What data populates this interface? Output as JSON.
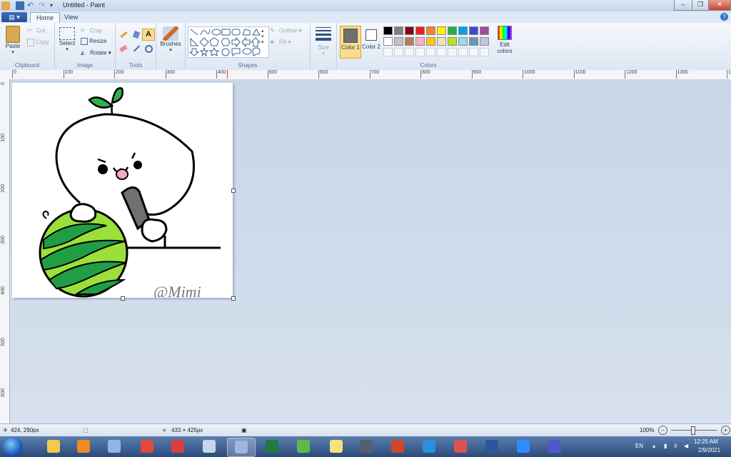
{
  "window": {
    "title": "Untitled - Paint",
    "min": "–",
    "max": "❐",
    "close": "✕"
  },
  "tabs": {
    "file": "▤ ▾",
    "home": "Home",
    "view": "View",
    "help": "?"
  },
  "clipboard": {
    "paste": "Paste",
    "cut": "Cut",
    "copy": "Copy",
    "label": "Clipboard"
  },
  "image": {
    "select": "Select",
    "crop": "Crop",
    "resize": "Resize",
    "rotate": "Rotate ▾",
    "label": "Image"
  },
  "tools": {
    "label": "Tools"
  },
  "brushes": {
    "label": "Brushes"
  },
  "shapes": {
    "outline": "Outline ▾",
    "fill": "Fill ▾",
    "label": "Shapes"
  },
  "size": {
    "label": "Size"
  },
  "colors": {
    "color1": "Color 1",
    "color2": "Color 2",
    "edit": "Edit colors",
    "label": "Colors",
    "color1_value": "#707070",
    "color2_value": "#ffffff",
    "row1": [
      "#000000",
      "#7f7f7f",
      "#880015",
      "#ed1c24",
      "#ff7f27",
      "#fff200",
      "#22b14c",
      "#00a2e8",
      "#3f48cc",
      "#a349a4"
    ],
    "row2": [
      "#ffffff",
      "#c3c3c3",
      "#b97a57",
      "#ffaec9",
      "#ffc90e",
      "#efe4b0",
      "#b5e61d",
      "#99d9ea",
      "#7092be",
      "#c8bfe7"
    ]
  },
  "ruler": {
    "h": [
      "0",
      "100",
      "200",
      "300",
      "400",
      "500",
      "600",
      "700",
      "800",
      "900",
      "1000",
      "1100",
      "1200",
      "1300",
      "14"
    ],
    "v": [
      "0",
      "100",
      "200",
      "300",
      "400",
      "500",
      "600"
    ]
  },
  "canvas": {
    "signature": "@Mimi"
  },
  "status": {
    "cursor": "424, 290px",
    "selection": "433 × 425px",
    "zoom": "100%"
  },
  "taskbar": {
    "lang": "EN",
    "time": "12:25 AM",
    "date": "2/9/2021"
  }
}
